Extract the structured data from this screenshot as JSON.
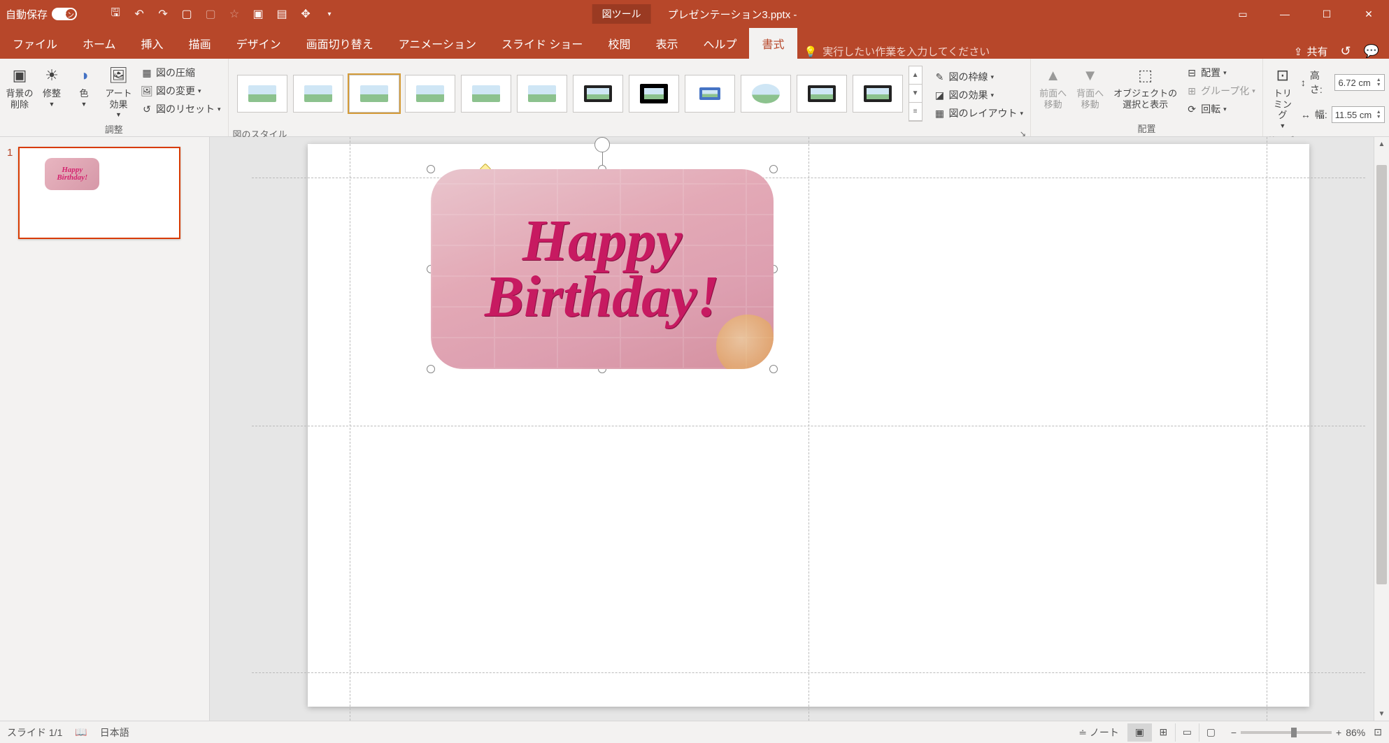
{
  "title_bar": {
    "autosave_label": "自動保存",
    "autosave_state": "オン",
    "context_tab": "図ツール",
    "filename": "プレゼンテーション3.pptx -"
  },
  "tabs": {
    "file": "ファイル",
    "home": "ホーム",
    "insert": "挿入",
    "draw": "描画",
    "design": "デザイン",
    "transitions": "画面切り替え",
    "animations": "アニメーション",
    "slideshow": "スライド ショー",
    "review": "校閲",
    "view": "表示",
    "help": "ヘルプ",
    "format": "書式",
    "tell_me": "実行したい作業を入力してください",
    "share": "共有"
  },
  "ribbon": {
    "adjust": {
      "remove_bg": "背景の\n削除",
      "corrections": "修整",
      "color": "色",
      "artistic": "アート効果",
      "compress": "図の圧縮",
      "change": "図の変更",
      "reset": "図のリセット",
      "group_label": "調整"
    },
    "styles": {
      "group_label": "図のスタイル",
      "border": "図の枠線",
      "effects": "図の効果",
      "layout": "図のレイアウト"
    },
    "arrange": {
      "bring_forward": "前面へ\n移動",
      "send_backward": "背面へ\n移動",
      "selection_pane": "オブジェクトの\n選択と表示",
      "align": "配置",
      "group": "グループ化",
      "rotate": "回転",
      "group_label": "配置"
    },
    "size": {
      "crop": "トリミング",
      "height_label": "高さ:",
      "height_val": "6.72 cm",
      "width_label": "幅:",
      "width_val": "11.55 cm",
      "group_label": "サイズ"
    }
  },
  "slide": {
    "number": "1",
    "image_text_1": "Happy",
    "image_text_2": "Birthday!"
  },
  "status": {
    "slide_counter": "スライド 1/1",
    "language": "日本語",
    "notes": "ノート",
    "zoom_pct": "86%"
  }
}
